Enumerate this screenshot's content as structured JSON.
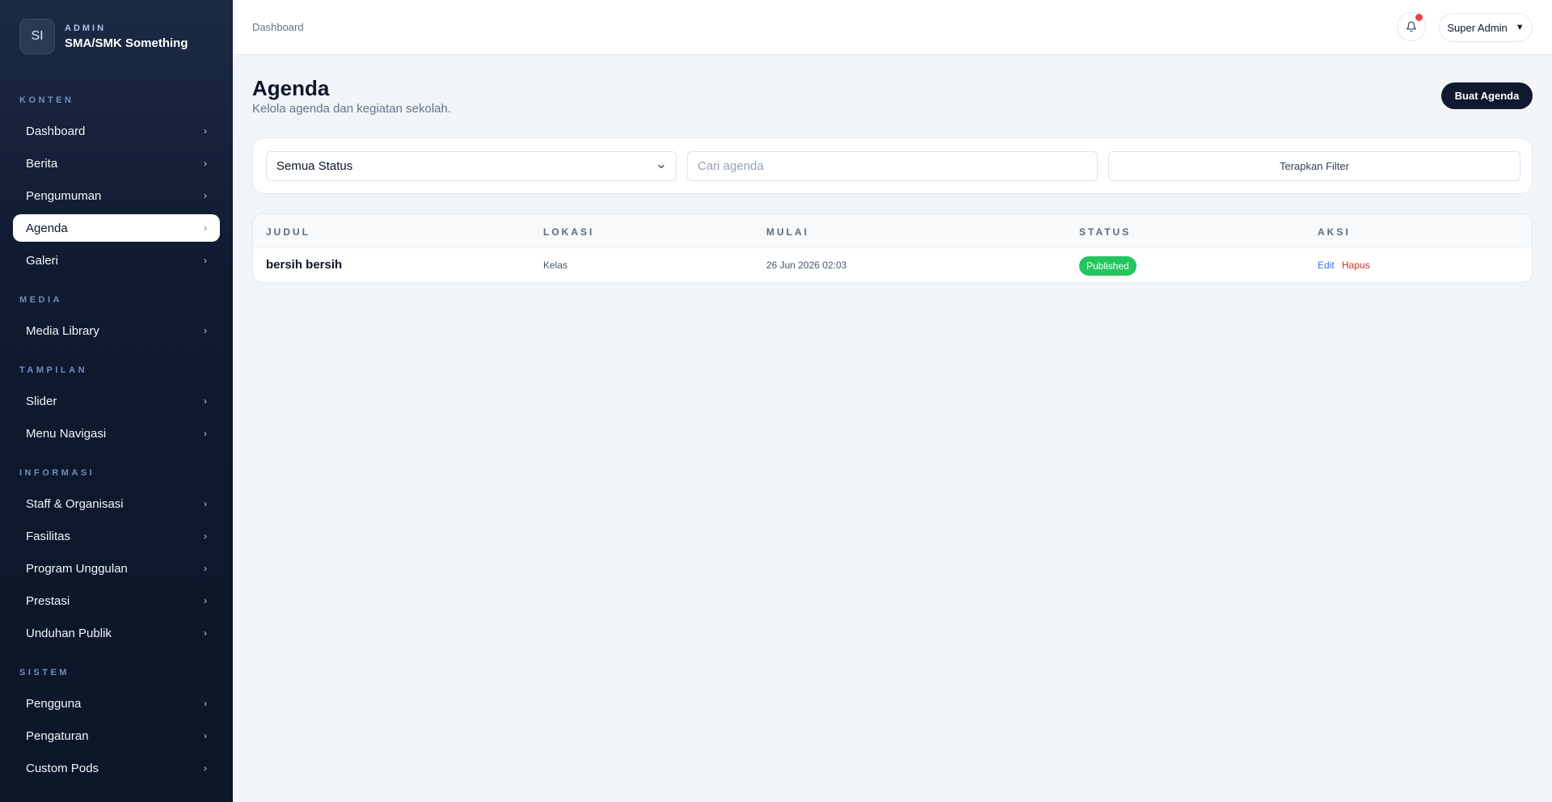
{
  "brand": {
    "logo_initials": "SI",
    "kicker": "ADMIN",
    "name": "SMA/SMK Something"
  },
  "sidebar": {
    "sections": {
      "konten": "KONTEN",
      "media": "MEDIA",
      "tampilan": "TAMPILAN",
      "informasi": "INFORMASI",
      "sistem": "SISTEM"
    },
    "items": {
      "dashboard": "Dashboard",
      "berita": "Berita",
      "pengumuman": "Pengumuman",
      "agenda": "Agenda",
      "galeri": "Galeri",
      "media_library": "Media Library",
      "slider": "Slider",
      "menu_navigasi": "Menu Navigasi",
      "staff": "Staff & Organisasi",
      "fasilitas": "Fasilitas",
      "program": "Program Unggulan",
      "prestasi": "Prestasi",
      "unduhan": "Unduhan Publik",
      "pengguna": "Pengguna",
      "pengaturan": "Pengaturan",
      "custom_pods": "Custom Pods"
    },
    "active": "Agenda",
    "chevron": "›"
  },
  "topbar": {
    "breadcrumb": "Dashboard",
    "user_label": "Super Admin",
    "user_caret": "▼",
    "has_notification": true
  },
  "page": {
    "title": "Agenda",
    "subtitle": "Kelola agenda dan kegiatan sekolah.",
    "primary_button": "Buat Agenda"
  },
  "filters": {
    "status_value": "Semua Status",
    "search_placeholder": "Cari agenda",
    "apply_label": "Terapkan Filter"
  },
  "table": {
    "columns": {
      "judul": "JUDUL",
      "lokasi": "LOKASI",
      "mulai": "MULAI",
      "status": "STATUS",
      "aksi": "AKSI"
    },
    "rows": [
      {
        "judul": "bersih bersih",
        "lokasi": "Kelas",
        "mulai": "26 Jun 2026 02:03",
        "status": "Published",
        "edit": "Edit",
        "hapus": "Hapus"
      }
    ]
  },
  "colors": {
    "sidebar_bg": "#0e1a2e",
    "primary": "#0f1a2f",
    "status_published": "#22c55e",
    "edit_link": "#3b6fd9",
    "delete_link": "#dc2626",
    "notification_dot": "#ef4444"
  }
}
